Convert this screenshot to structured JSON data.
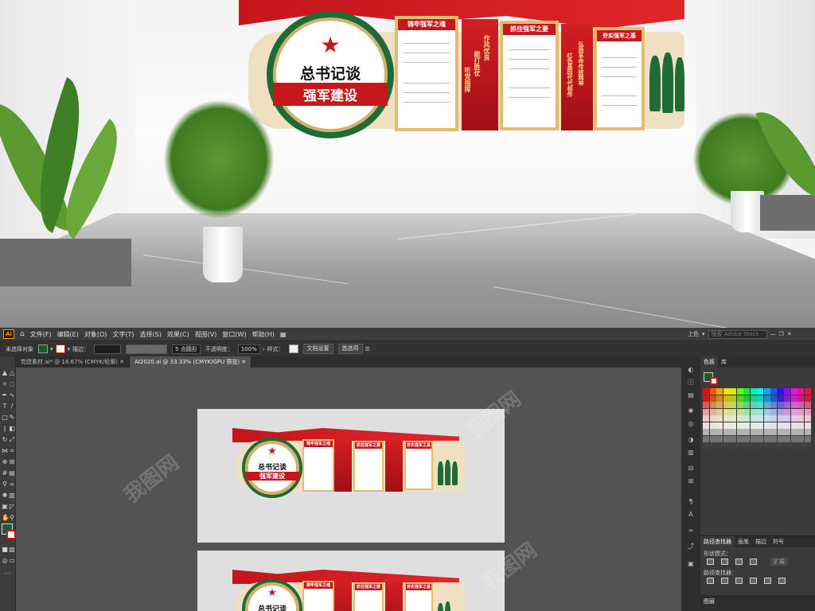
{
  "scene": {
    "emblem_title_line1": "总书记谈",
    "emblem_title_line2": "强军建设",
    "emblem_star": "八",
    "boards": [
      {
        "heading": "铸牢强军之魂"
      },
      {
        "heading": "抓住强军之要"
      },
      {
        "heading": "夯实强军之基"
      }
    ],
    "red_boards": [
      {
        "text_a": "作风优良",
        "text_b": "能打胜仗",
        "text_c": "听党指挥"
      },
      {
        "text_a": "弘扬革命传统精神",
        "text_b": "红色基因代代相传"
      }
    ],
    "watermark": "我图网"
  },
  "app": {
    "logo": "Ai",
    "menus": [
      "文件(F)",
      "编辑(E)",
      "对象(O)",
      "文字(T)",
      "选择(S)",
      "效果(C)",
      "视图(V)",
      "窗口(W)",
      "帮助(H)"
    ],
    "workspace": "上色",
    "search_placeholder": "搜索 Adobe Stock",
    "control_bar": {
      "selection_label": "未选择对象",
      "stroke_label": "描边：",
      "brush_label": "5 点圆形",
      "opacity_label": "不透明度：",
      "opacity_value": "100%",
      "style_label": "样式：",
      "doc_setup_button": "文档设置",
      "prefs_button": "首选项"
    },
    "doc_tabs": [
      {
        "label": "党建素材.ai* @ 16.67% (CMYK/轮廓)",
        "active": false
      },
      {
        "label": "AI2020.ai @ 33.33% (CMYK/GPU 预览)",
        "active": true
      }
    ],
    "swatch_panel": {
      "tabs": [
        "色板",
        "库"
      ]
    },
    "pathfinder_panel": {
      "tabs": [
        "路径查找器",
        "画笔",
        "描边",
        "符号"
      ],
      "shape_mode_label": "形状模式：",
      "pathfinder_label": "路径查找器：",
      "expand_button": "扩展"
    },
    "layers_tab": "图层",
    "colors": {
      "brand_red": "#c8161d",
      "gold": "#e1bd6f",
      "army_green": "#1e6b37",
      "ui_dark": "#3c3c3c"
    }
  }
}
